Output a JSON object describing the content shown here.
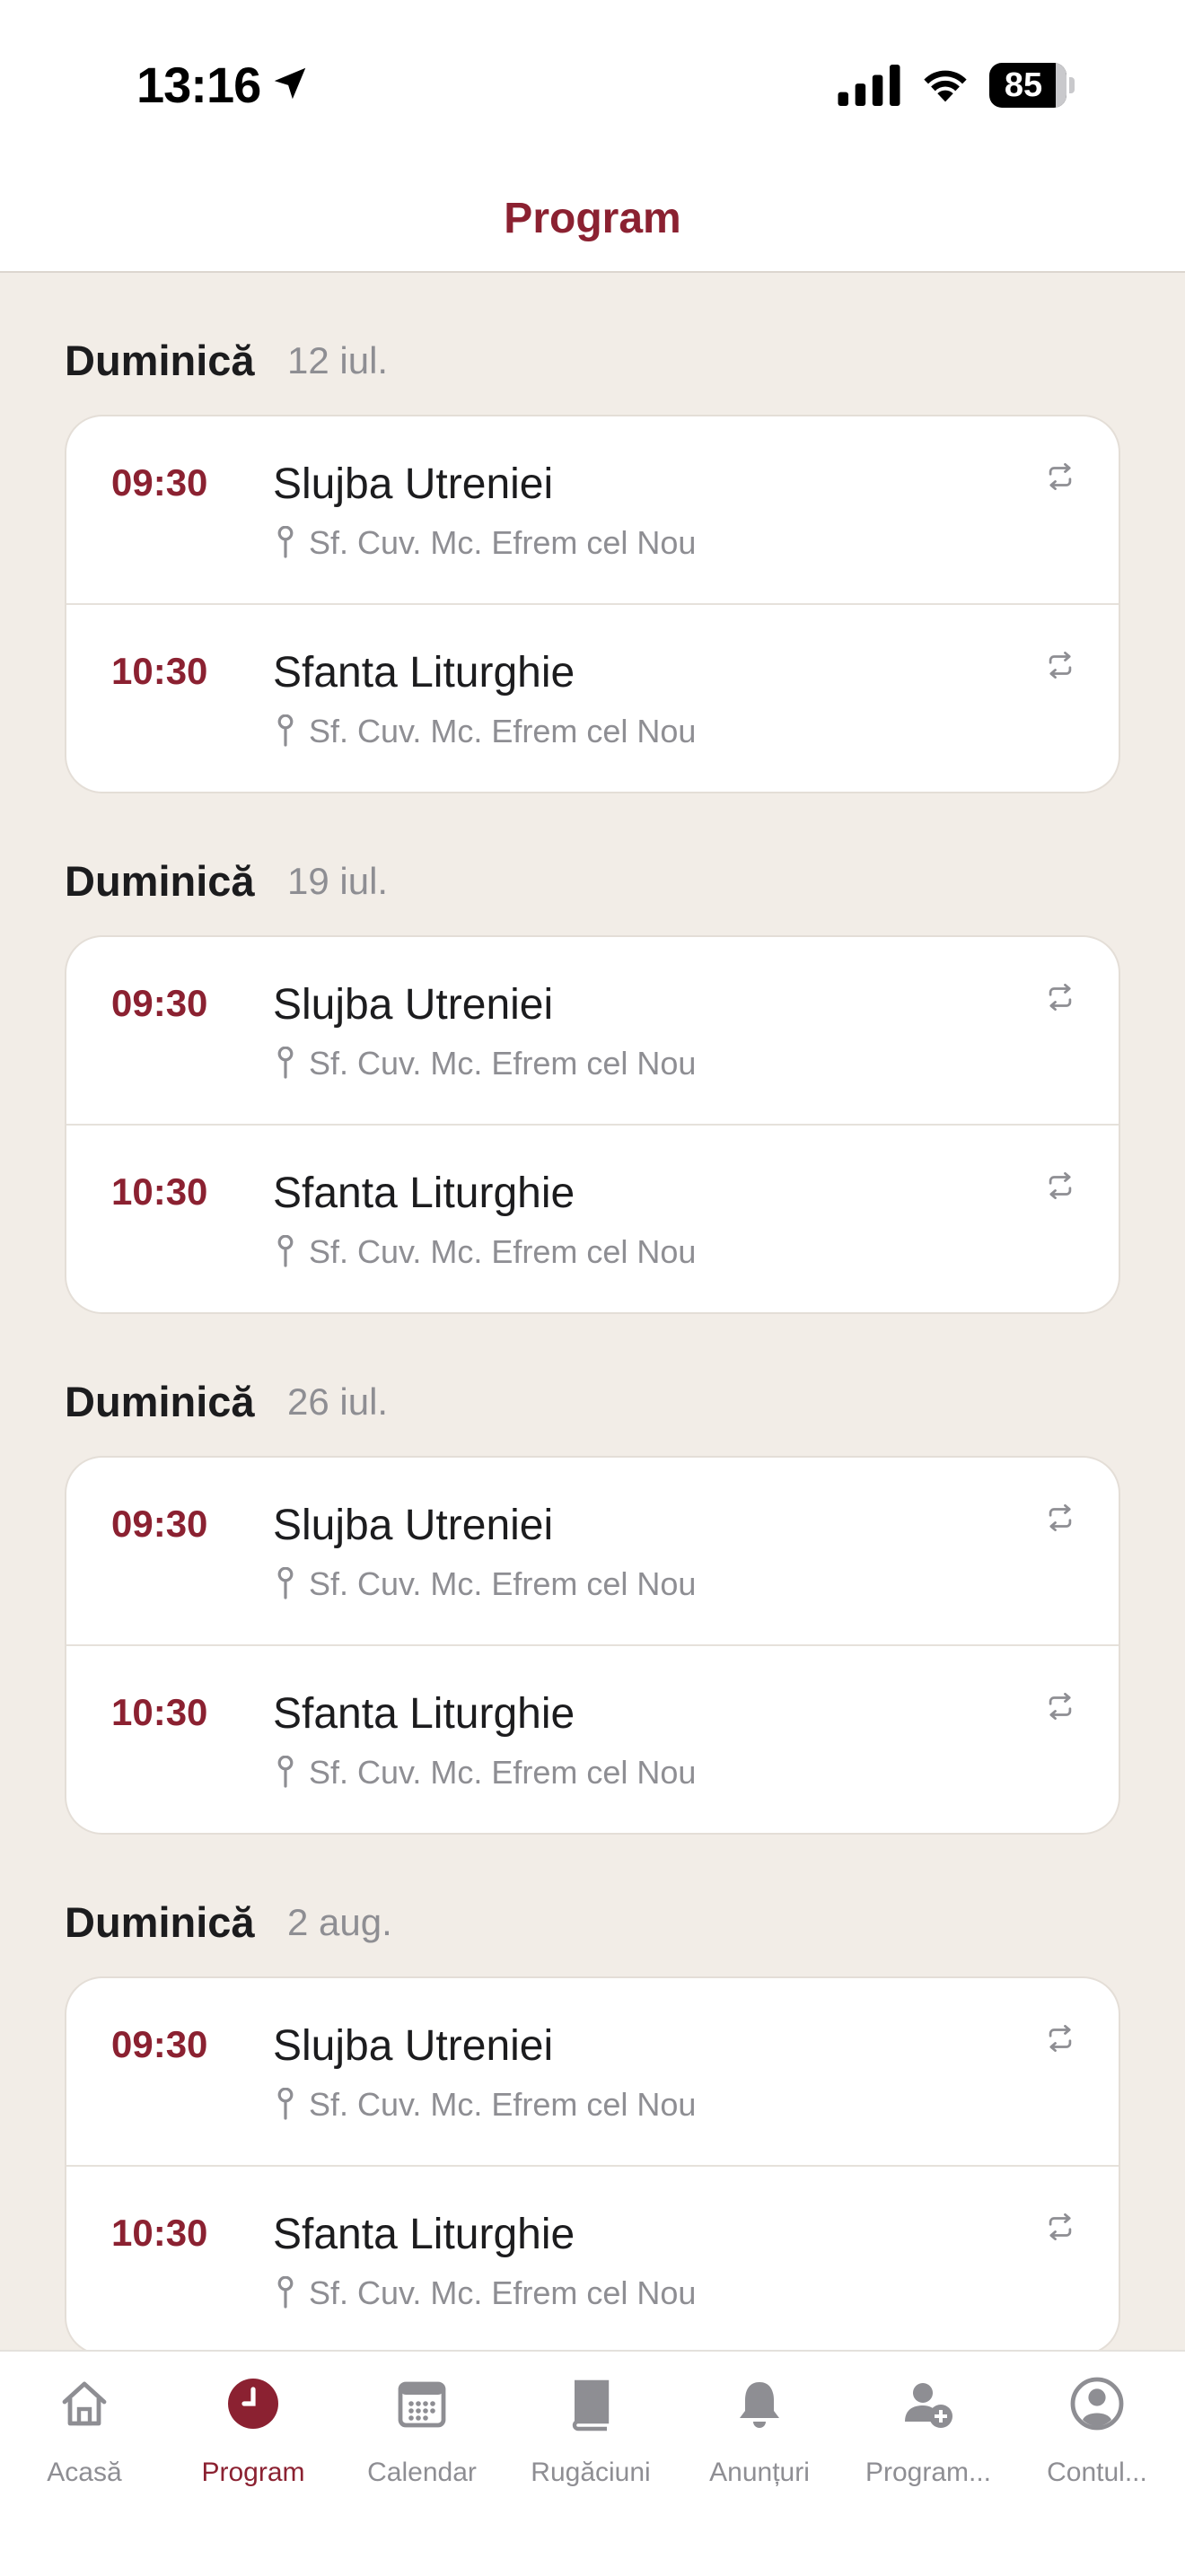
{
  "status_bar": {
    "time": "13:16",
    "battery": "85"
  },
  "header": {
    "title": "Program"
  },
  "sections": [
    {
      "day": "Duminică",
      "date": "12 iul.",
      "events": [
        {
          "time": "09:30",
          "title": "Slujba Utreniei",
          "place": "Sf. Cuv. Mc. Efrem cel Nou"
        },
        {
          "time": "10:30",
          "title": "Sfanta Liturghie",
          "place": "Sf. Cuv. Mc. Efrem cel Nou"
        }
      ]
    },
    {
      "day": "Duminică",
      "date": "19 iul.",
      "events": [
        {
          "time": "09:30",
          "title": "Slujba Utreniei",
          "place": "Sf. Cuv. Mc. Efrem cel Nou"
        },
        {
          "time": "10:30",
          "title": "Sfanta Liturghie",
          "place": "Sf. Cuv. Mc. Efrem cel Nou"
        }
      ]
    },
    {
      "day": "Duminică",
      "date": "26 iul.",
      "events": [
        {
          "time": "09:30",
          "title": "Slujba Utreniei",
          "place": "Sf. Cuv. Mc. Efrem cel Nou"
        },
        {
          "time": "10:30",
          "title": "Sfanta Liturghie",
          "place": "Sf. Cuv. Mc. Efrem cel Nou"
        }
      ]
    },
    {
      "day": "Duminică",
      "date": "2 aug.",
      "events": [
        {
          "time": "09:30",
          "title": "Slujba Utreniei",
          "place": "Sf. Cuv. Mc. Efrem cel Nou"
        },
        {
          "time": "10:30",
          "title": "Sfanta Liturghie",
          "place": "Sf. Cuv. Mc. Efrem cel Nou"
        }
      ]
    }
  ],
  "tab_bar": {
    "tabs": [
      {
        "label": "Acasă",
        "icon": "home-icon"
      },
      {
        "label": "Program",
        "icon": "clock-icon",
        "active": true
      },
      {
        "label": "Calendar",
        "icon": "calendar-icon"
      },
      {
        "label": "Rugăciuni",
        "icon": "book-icon"
      },
      {
        "label": "Anunțuri",
        "icon": "bell-icon"
      },
      {
        "label": "Program...",
        "icon": "add-person-icon"
      },
      {
        "label": "Contul...",
        "icon": "account-icon"
      }
    ]
  },
  "colors": {
    "accent": "#8b2131",
    "background": "#f2ede7",
    "muted": "#8e8e93"
  }
}
